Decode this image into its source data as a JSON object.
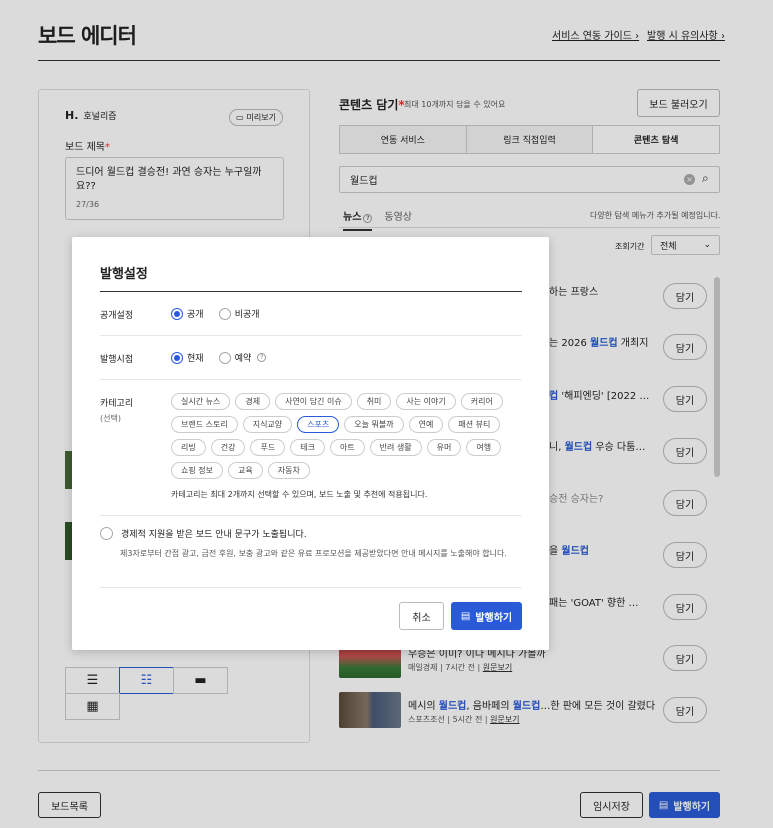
{
  "header": {
    "title": "보드 에디터",
    "links": [
      "서비스 연동 가이드",
      "발행 시 유의사항"
    ]
  },
  "editor": {
    "brand_logo": "H.",
    "brand_name": "호널리즘",
    "preview_label": "미리보기",
    "board_title_label": "보드 제목",
    "board_title_value": "드디어 월드컵 결승전! 과연 승자는 누구일까요??",
    "counter": "27/36"
  },
  "content": {
    "title": "콘텐츠 담기",
    "subtitle": "최대 10개까지 담을 수 있어요",
    "load_button": "보드 불러오기",
    "tabs": [
      "연동 서비스",
      "링크 직접입력",
      "콘텐츠 탐색"
    ],
    "search_value": "월드컵",
    "subtabs": [
      "뉴스",
      "동영상"
    ],
    "hint": "다양한 탐색 메뉴가 추가될 예정입니다.",
    "period_label": "조회기간",
    "period_value": "전체",
    "add_label": "담기",
    "items": [
      {
        "title_pre": "",
        "title_hl": "",
        "title_post": "하는 프랑스"
      },
      {
        "title_pre": "는 2026 ",
        "title_hl": "월드컵",
        "title_post": " 개최지"
      },
      {
        "title_pre": "",
        "title_hl": "컵",
        "title_post": " '해피엔딩' [2022 …"
      },
      {
        "title_pre": "니, ",
        "title_hl": "월드컵",
        "title_post": " 우승 다툼…"
      },
      {
        "title_pre": "",
        "title_hl": "",
        "title_post": "승전 승자는?"
      },
      {
        "title_pre": "을 ",
        "title_hl": "월드컵",
        "title_post": ""
      },
      {
        "title_pre": "",
        "title_hl": "",
        "title_post": "패는 'GOAT' 향한 …"
      },
      {
        "title_pre": "우승은 ",
        "title_hl": "",
        "title_post": "이미? 이다 메시다 가볼까",
        "source": "매일경제",
        "time": "7시간 전",
        "link": "원문보기"
      },
      {
        "title_pre": "메시의 ",
        "title_hl": "월드컵",
        "title_mid": ", 음바페의 ",
        "title_hl2": "월드컵",
        "title_post": "…한 판에 모든 것이 갈렸다",
        "source": "스포츠조선",
        "time": "5시간 전",
        "link": "원문보기"
      }
    ]
  },
  "footer": {
    "list_button": "보드목록",
    "temp_save": "임시저장",
    "publish": "발행하기"
  },
  "modal": {
    "title": "발행설정",
    "visibility_label": "공개설정",
    "visibility_options": [
      "공개",
      "비공개"
    ],
    "time_label": "발행시점",
    "time_options": [
      "현재",
      "예약"
    ],
    "category_label": "카테고리",
    "category_sub": "(선택)",
    "categories": [
      "실시간 뉴스",
      "경제",
      "사연이 담긴 이슈",
      "취미",
      "사는 이야기",
      "커리어",
      "브랜드 스토리",
      "지식교양",
      "스포츠",
      "오늘 뭐볼까",
      "연예",
      "패션 뷰티",
      "리빙",
      "건강",
      "푸드",
      "테크",
      "아트",
      "반려 생활",
      "유머",
      "여행",
      "쇼핑 정보",
      "교육",
      "자동차"
    ],
    "selected_category": "스포츠",
    "category_note": "카테고리는 최대 2개까지 선택할 수 있으며, 보드 노출 및 추천에 적용됩니다.",
    "notice_title": "경제적 지원을 받은 보드 안내 문구가 노출됩니다.",
    "notice_desc": "제3자로부터 간접 광고, 금전 후원, 보충 광고와 같은 유료 프로모션을 제공받았다면 안내 메시지를 노출해야 합니다.",
    "cancel": "취소",
    "publish": "발행하기",
    "accent": "#2a5bd7"
  }
}
